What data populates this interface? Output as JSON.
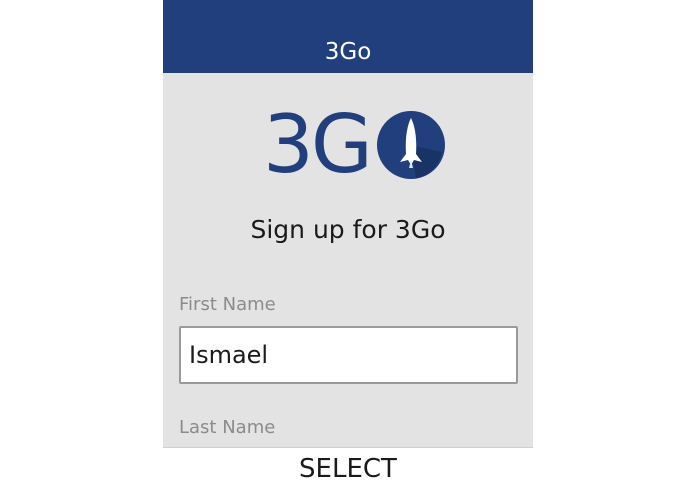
{
  "header": {
    "title": "3Go"
  },
  "logo": {
    "text": "3G"
  },
  "form": {
    "title": "Sign up for 3Go",
    "first_name_label": "First Name",
    "first_name_value": "Ismael",
    "last_name_label": "Last Name"
  },
  "softkey": {
    "select_label": "SELECT"
  },
  "colors": {
    "brand": "#213f7c",
    "background": "#e3e3e3"
  },
  "icons": {
    "logo_mark": "rocket-icon"
  }
}
